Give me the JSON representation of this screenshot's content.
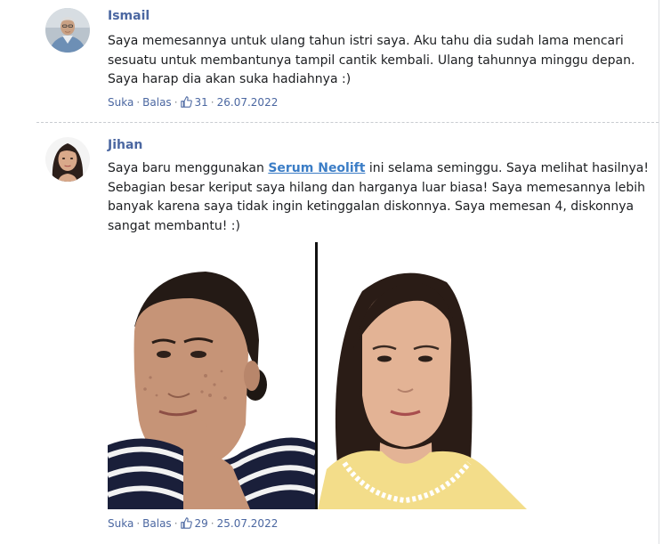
{
  "comments": [
    {
      "author": "Ismail",
      "text": "Saya memesannya untuk ulang tahun istri saya. Aku tahu dia sudah lama mencari sesuatu untuk membantunya tampil cantik kembali. Ulang tahunnya minggu depan. Saya harap dia akan suka hadiahnya :)",
      "like_label": "Suka",
      "reply_label": "Balas",
      "likes": "31",
      "date": "26.07.2022"
    },
    {
      "author": "Jihan",
      "text_before": "Saya baru menggunakan ",
      "link_text": "Serum Neolift",
      "text_after": " ini selama seminggu. Saya melihat hasilnya! Sebagian besar keriput saya hilang dan harganya luar biasa! Saya memesannya lebih banyak karena saya tidak ingin ketinggalan diskonnya. Saya memesan 4, diskonnya sangat membantu! :)",
      "like_label": "Suka",
      "reply_label": "Balas",
      "likes": "29",
      "date": "25.07.2022"
    }
  ],
  "separator": "·",
  "icons": {
    "like": "thumbs-up-icon"
  },
  "colors": {
    "author_name": "#4b67a1",
    "link": "#3b7dc6",
    "meta": "#4b67a1"
  }
}
